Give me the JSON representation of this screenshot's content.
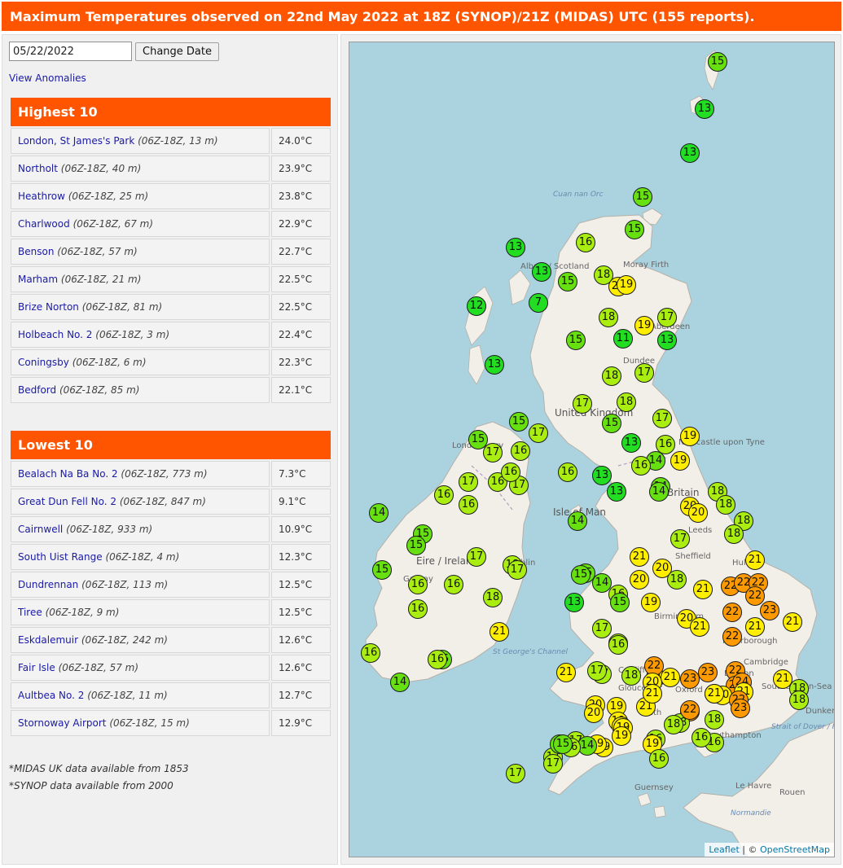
{
  "header": {
    "title": "Maximum Temperatures observed on 22nd May 2022 at 18Z (SYNOP)/21Z (MIDAS) UTC (155 reports)."
  },
  "controls": {
    "date_value": "05/22/2022",
    "change_date_label": "Change Date",
    "view_anomalies_label": "View Anomalies"
  },
  "highest": {
    "title": "Highest 10",
    "rows": [
      {
        "station": "London, St James's Park",
        "meta": "(06Z-18Z, 13 m)",
        "value": "24.0°C"
      },
      {
        "station": "Northolt",
        "meta": "(06Z-18Z, 40 m)",
        "value": "23.9°C"
      },
      {
        "station": "Heathrow",
        "meta": "(06Z-18Z, 25 m)",
        "value": "23.8°C"
      },
      {
        "station": "Charlwood",
        "meta": "(06Z-18Z, 67 m)",
        "value": "22.9°C"
      },
      {
        "station": "Benson",
        "meta": "(06Z-18Z, 57 m)",
        "value": "22.7°C"
      },
      {
        "station": "Marham",
        "meta": "(06Z-18Z, 21 m)",
        "value": "22.5°C"
      },
      {
        "station": "Brize Norton",
        "meta": "(06Z-18Z, 81 m)",
        "value": "22.5°C"
      },
      {
        "station": "Holbeach No. 2",
        "meta": "(06Z-18Z, 3 m)",
        "value": "22.4°C"
      },
      {
        "station": "Coningsby",
        "meta": "(06Z-18Z, 6 m)",
        "value": "22.3°C"
      },
      {
        "station": "Bedford",
        "meta": "(06Z-18Z, 85 m)",
        "value": "22.1°C"
      }
    ]
  },
  "lowest": {
    "title": "Lowest 10",
    "rows": [
      {
        "station": "Bealach Na Ba No. 2",
        "meta": "(06Z-18Z, 773 m)",
        "value": "7.3°C"
      },
      {
        "station": "Great Dun Fell No. 2",
        "meta": "(06Z-18Z, 847 m)",
        "value": "9.1°C"
      },
      {
        "station": "Cairnwell",
        "meta": "(06Z-18Z, 933 m)",
        "value": "10.9°C"
      },
      {
        "station": "South Uist Range",
        "meta": "(06Z-18Z, 4 m)",
        "value": "12.3°C"
      },
      {
        "station": "Dundrennan",
        "meta": "(06Z-18Z, 113 m)",
        "value": "12.5°C"
      },
      {
        "station": "Tiree",
        "meta": "(06Z-18Z, 9 m)",
        "value": "12.5°C"
      },
      {
        "station": "Eskdalemuir",
        "meta": "(06Z-18Z, 242 m)",
        "value": "12.6°C"
      },
      {
        "station": "Fair Isle",
        "meta": "(06Z-18Z, 57 m)",
        "value": "12.6°C"
      },
      {
        "station": "Aultbea No. 2",
        "meta": "(06Z-18Z, 11 m)",
        "value": "12.7°C"
      },
      {
        "station": "Stornoway Airport",
        "meta": "(06Z-18Z, 15 m)",
        "value": "12.9°C"
      }
    ]
  },
  "footnotes": [
    "*MIDAS UK data available from 1853",
    "*SYNOP data available from 2000"
  ],
  "map": {
    "labels": [
      "Cuan nan Orc",
      "Albain / Scotland",
      "Moray Firth",
      "Aberdeen",
      "Dundee",
      "United Kingdom",
      "Londonderry",
      "Newcastle upon Tyne",
      "Isle of Man",
      "Britain",
      "Leeds",
      "Sheffield",
      "Hull",
      "Eire / Ireland",
      "Dublin",
      "Galway",
      "Cork",
      "Birmingham",
      "Peterborough",
      "Cambridge",
      "St George's Channel",
      "Cardiff",
      "Gloucester",
      "Oxford",
      "London",
      "Bath",
      "Southampton",
      "Southend-on-Sea",
      "Strait of Dover / Pas de Calais",
      "Guernsey",
      "Le Havre",
      "Rouen",
      "Normandie",
      "Dunkerque"
    ],
    "attribution_leaflet": "Leaflet",
    "attribution_sep": " | © ",
    "attribution_osm": "OpenStreetMap",
    "marker_colors": {
      "cold": "#22dd22",
      "cool": "#66e011",
      "mild": "#aaee11",
      "warm": "#ffee00",
      "hot": "#ff9900"
    },
    "markers": [
      {
        "t": 15
      },
      {
        "t": 13
      },
      {
        "t": 13
      },
      {
        "t": 15
      },
      {
        "t": 15
      },
      {
        "t": 13
      },
      {
        "t": 16
      },
      {
        "t": 13
      },
      {
        "t": 15
      },
      {
        "t": 18
      },
      {
        "t": 20
      },
      {
        "t": 19
      },
      {
        "t": 12
      },
      {
        "t": 7
      },
      {
        "t": 18
      },
      {
        "t": 19
      },
      {
        "t": 17
      },
      {
        "t": 15
      },
      {
        "t": 11
      },
      {
        "t": 13
      },
      {
        "t": 13
      },
      {
        "t": 18
      },
      {
        "t": 17
      },
      {
        "t": 15
      },
      {
        "t": 17
      },
      {
        "t": 18
      },
      {
        "t": 17
      },
      {
        "t": 15
      },
      {
        "t": 17
      },
      {
        "t": 19
      },
      {
        "t": 15
      },
      {
        "t": 17
      },
      {
        "t": 16
      },
      {
        "t": 13
      },
      {
        "t": 16
      },
      {
        "t": 19
      },
      {
        "t": 16
      },
      {
        "t": 14
      },
      {
        "t": 17
      },
      {
        "t": 16
      },
      {
        "t": 17
      },
      {
        "t": 16
      },
      {
        "t": 13
      },
      {
        "t": 16
      },
      {
        "t": 14
      },
      {
        "t": 14
      },
      {
        "t": 13
      },
      {
        "t": 16
      },
      {
        "t": 16
      },
      {
        "t": 14
      },
      {
        "t": 15
      },
      {
        "t": 15
      },
      {
        "t": 18
      },
      {
        "t": 18
      },
      {
        "t": 20
      },
      {
        "t": 20
      },
      {
        "t": 18
      },
      {
        "t": 18
      },
      {
        "t": 17
      },
      {
        "t": 14
      },
      {
        "t": 21
      },
      {
        "t": 15
      },
      {
        "t": 15
      },
      {
        "t": 17
      },
      {
        "t": 18
      },
      {
        "t": 17
      },
      {
        "t": 20
      },
      {
        "t": 21
      },
      {
        "t": 15
      },
      {
        "t": 14
      },
      {
        "t": 16
      },
      {
        "t": 20
      },
      {
        "t": 18
      },
      {
        "t": 21
      },
      {
        "t": 22
      },
      {
        "t": 22
      },
      {
        "t": 22
      },
      {
        "t": 22
      },
      {
        "t": 16
      },
      {
        "t": 13
      },
      {
        "t": 15
      },
      {
        "t": 19
      },
      {
        "t": 18
      },
      {
        "t": 23
      },
      {
        "t": 22
      },
      {
        "t": 17
      },
      {
        "t": 16
      },
      {
        "t": 20
      },
      {
        "t": 21
      },
      {
        "t": 21
      },
      {
        "t": 22
      },
      {
        "t": 21
      },
      {
        "t": 16
      },
      {
        "t": 21
      },
      {
        "t": 16
      },
      {
        "t": 16
      },
      {
        "t": 14
      },
      {
        "t": 15
      },
      {
        "t": 16
      },
      {
        "t": 16
      },
      {
        "t": 17
      },
      {
        "t": 21
      },
      {
        "t": 21
      },
      {
        "t": 23
      },
      {
        "t": 22
      },
      {
        "t": 23
      },
      {
        "t": 22
      },
      {
        "t": 24
      },
      {
        "t": 24
      },
      {
        "t": 21
      },
      {
        "t": 21
      },
      {
        "t": 20
      },
      {
        "t": 21
      },
      {
        "t": 20
      },
      {
        "t": 22
      },
      {
        "t": 23
      },
      {
        "t": 22
      },
      {
        "t": 21
      },
      {
        "t": 18
      },
      {
        "t": 18
      },
      {
        "t": 20
      },
      {
        "t": 19
      },
      {
        "t": 21
      },
      {
        "t": 19
      },
      {
        "t": 19
      },
      {
        "t": 18
      },
      {
        "t": 19
      },
      {
        "t": 17
      },
      {
        "t": 19
      },
      {
        "t": 18
      },
      {
        "t": 16
      },
      {
        "t": 16
      },
      {
        "t": 18
      },
      {
        "t": 19
      },
      {
        "t": 16
      },
      {
        "t": 17
      },
      {
        "t": 17
      },
      {
        "t": 19
      },
      {
        "t": 19
      },
      {
        "t": 16
      },
      {
        "t": 17
      },
      {
        "t": 14
      },
      {
        "t": 16
      },
      {
        "t": 15
      },
      {
        "t": 15
      },
      {
        "t": 22
      },
      {
        "t": 20
      },
      {
        "t": 21
      },
      {
        "t": 21
      },
      {
        "t": 18
      },
      {
        "t": 17
      }
    ]
  }
}
